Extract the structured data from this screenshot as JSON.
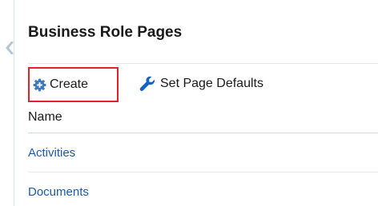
{
  "page": {
    "title": "Business Role Pages"
  },
  "toolbar": {
    "create_label": "Create",
    "create_icon": "add-gear-icon",
    "set_defaults_label": "Set Page Defaults",
    "set_defaults_icon": "wrench-icon",
    "highlight_color": "#e0242c"
  },
  "table": {
    "columns": [
      "Name"
    ],
    "rows": [
      {
        "name": "Activities"
      },
      {
        "name": "Documents"
      }
    ],
    "link_color": "#1f5aa6"
  },
  "sidebar": {
    "collapse_icon": "chevron-left-icon"
  }
}
